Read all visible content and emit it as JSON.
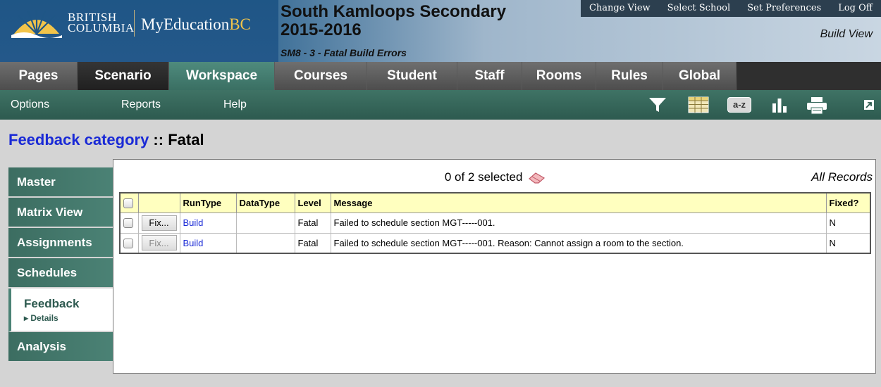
{
  "branding": {
    "bc_line1": "BRITISH",
    "bc_line2": "COLUMBIA",
    "product": "MyEducation",
    "product_suffix": "BC"
  },
  "header": {
    "school": "South Kamloops Secondary",
    "year": "2015-2016",
    "context": "SM8 - 3 - Fatal Build Errors",
    "view": "Build View"
  },
  "top_links": [
    "Change View",
    "Select School",
    "Set Preferences",
    "Log Off"
  ],
  "tabs": [
    {
      "label": "Pages"
    },
    {
      "label": "Scenario"
    },
    {
      "label": "Workspace"
    },
    {
      "label": "Courses"
    },
    {
      "label": "Student"
    },
    {
      "label": "Staff"
    },
    {
      "label": "Rooms"
    },
    {
      "label": "Rules"
    },
    {
      "label": "Global"
    }
  ],
  "submenu": [
    "Options",
    "Reports",
    "Help"
  ],
  "toolbar": {
    "sort_label": "a-z",
    "icons": [
      "filter-icon",
      "grid-icon",
      "sort-az-icon",
      "chart-icon",
      "print-icon",
      "popout-icon"
    ]
  },
  "page_title": {
    "link": "Feedback category",
    "separator": " :: ",
    "value": "Fatal"
  },
  "sidenav": {
    "items": [
      "Master",
      "Matrix View",
      "Assignments",
      "Schedules",
      "Feedback",
      "Analysis"
    ],
    "feedback_sub": "▸ Details"
  },
  "list": {
    "selected_text": "0 of 2 selected",
    "scope": "All Records",
    "columns": [
      "",
      "",
      "RunType",
      "DataType",
      "Level",
      "Message",
      "Fixed?"
    ],
    "fix_label": "Fix...",
    "rows": [
      {
        "runtype": "Build",
        "datatype": "",
        "level": "Fatal",
        "message": "Failed to schedule section MGT-----001.",
        "fixed": "N"
      },
      {
        "runtype": "Build",
        "datatype": "",
        "level": "Fatal",
        "message": "Failed to schedule section MGT-----001. Reason: Cannot assign a room to the section.",
        "fixed": "N"
      }
    ]
  },
  "colors": {
    "accent_green": "#3f7365",
    "link_blue": "#1a2ad6",
    "header_yellow": "#ffffbf"
  }
}
